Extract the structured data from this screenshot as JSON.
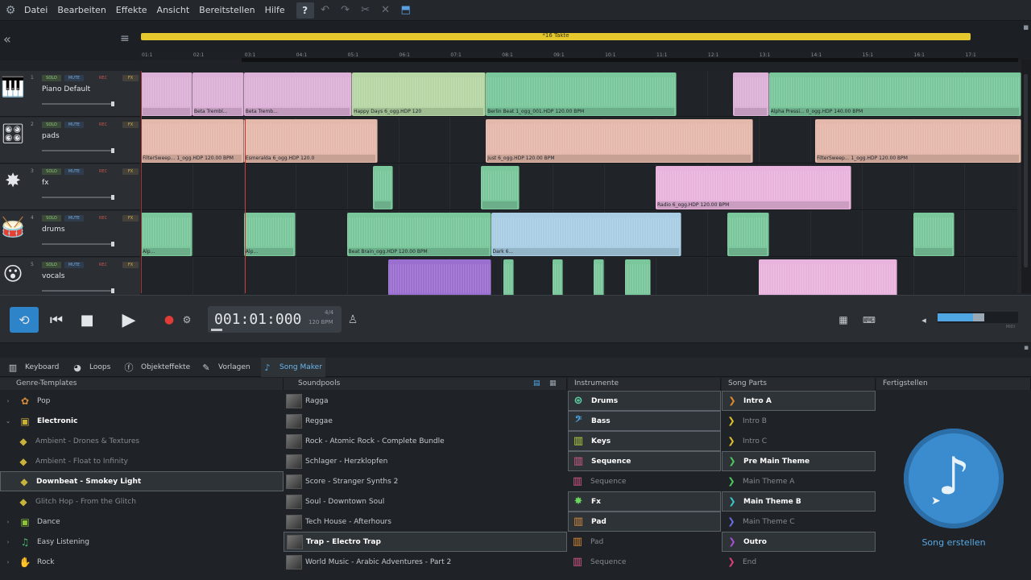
{
  "menu": {
    "items": [
      "Datei",
      "Bearbeiten",
      "Effekte",
      "Ansicht",
      "Bereitstellen",
      "Hilfe"
    ]
  },
  "arranger": {
    "loop_label": "*16 Takte",
    "ruler_ticks": [
      "01:1",
      "02:1",
      "03:1",
      "04:1",
      "05:1",
      "06:1",
      "07:1",
      "08:1",
      "09:1",
      "10:1",
      "11:1",
      "12:1",
      "13:1",
      "14:1",
      "15:1",
      "16:1",
      "17:1"
    ]
  },
  "tracks": [
    {
      "num": "1",
      "name": "Piano Default",
      "icon": "piano-icon",
      "icon_glyph": "🎹",
      "clips": [
        {
          "start": 0,
          "len": 1.0,
          "color": "c-pink",
          "label": ""
        },
        {
          "start": 1.0,
          "len": 1.0,
          "color": "c-pink",
          "label": "Beta Trembl..."
        },
        {
          "start": 2.0,
          "len": 2.1,
          "color": "c-pink",
          "label": "Beta Tremb..."
        },
        {
          "start": 4.1,
          "len": 2.6,
          "color": "c-lgreen",
          "label": "Happy Days 6_ogg.HDP 120"
        },
        {
          "start": 6.7,
          "len": 3.7,
          "color": "c-green",
          "label": "Berlin Beat 1_ogg_001.HDP 120.00 BPM"
        },
        {
          "start": 11.5,
          "len": 0.7,
          "color": "c-pink",
          "label": ""
        },
        {
          "start": 12.2,
          "len": 4.9,
          "color": "c-green",
          "label": "Alpha Pressi... 0_ogg.HDP 140.00 BPM"
        }
      ]
    },
    {
      "num": "2",
      "name": "pads",
      "icon": "keyboard-icon",
      "icon_glyph": "🎛",
      "clips": [
        {
          "start": 0,
          "len": 2.0,
          "color": "c-salmon",
          "label": "FilterSweep... 1_ogg.HDP 120.00 BPM"
        },
        {
          "start": 2.0,
          "len": 2.6,
          "color": "c-salmon",
          "label": "Esmeralda 6_ogg.HDP 120.0"
        },
        {
          "start": 6.7,
          "len": 5.2,
          "color": "c-salmon",
          "label": "Just 6_ogg.HDP 120.00 BPM"
        },
        {
          "start": 13.1,
          "len": 4.0,
          "color": "c-salmon",
          "label": "FilterSweep... 1_ogg.HDP 120.00 BPM"
        }
      ]
    },
    {
      "num": "3",
      "name": "fx",
      "icon": "fx-burst-icon",
      "icon_glyph": "✸",
      "clips": [
        {
          "start": 4.5,
          "len": 0.4,
          "color": "c-green",
          "label": ""
        },
        {
          "start": 6.6,
          "len": 0.75,
          "color": "c-green",
          "label": ""
        },
        {
          "start": 10.0,
          "len": 3.8,
          "color": "c-pinkv",
          "label": "Radio 6_ogg.HDP 120.00 BPM"
        }
      ]
    },
    {
      "num": "4",
      "name": "drums",
      "icon": "drums-icon",
      "icon_glyph": "🥁",
      "clips": [
        {
          "start": 0,
          "len": 1.0,
          "color": "c-green",
          "label": "Alp..."
        },
        {
          "start": 2.0,
          "len": 1.0,
          "color": "c-green",
          "label": "Alp..."
        },
        {
          "start": 4.0,
          "len": 2.8,
          "color": "c-green",
          "label": "Beat Brain_ogg.HDP 120.00 BPM"
        },
        {
          "start": 6.8,
          "len": 3.7,
          "color": "c-blue",
          "label": "Dark 6..."
        },
        {
          "start": 11.4,
          "len": 0.8,
          "color": "c-green",
          "label": ""
        },
        {
          "start": 15.0,
          "len": 0.8,
          "color": "c-green",
          "label": ""
        }
      ]
    },
    {
      "num": "5",
      "name": "vocals",
      "icon": "vocals-icon",
      "icon_glyph": "😮",
      "clips": [
        {
          "start": 4.8,
          "len": 2.0,
          "color": "c-purple",
          "label": ""
        },
        {
          "start": 7.05,
          "len": 0.2,
          "color": "c-green",
          "label": ""
        },
        {
          "start": 8.0,
          "len": 0.2,
          "color": "c-green",
          "label": ""
        },
        {
          "start": 8.8,
          "len": 0.2,
          "color": "c-green",
          "label": ""
        },
        {
          "start": 9.4,
          "len": 0.5,
          "color": "c-green",
          "label": ""
        },
        {
          "start": 12.0,
          "len": 2.7,
          "color": "c-pinkv",
          "label": ""
        }
      ]
    }
  ],
  "track_buttons": {
    "solo": "SOLO",
    "mute": "MUTE",
    "rec": "REC",
    "fx": "FX"
  },
  "transport": {
    "time": "001:01:000",
    "signature": "4/4",
    "bpm": "120 BPM",
    "midi_label": "MIDI",
    "volume_level": 0.44
  },
  "tabs": [
    {
      "label": "Keyboard",
      "icon": "keyboard-icon",
      "glyph": "▥"
    },
    {
      "label": "Loops",
      "icon": "loops-icon",
      "glyph": "◕"
    },
    {
      "label": "Objekteffekte",
      "icon": "object-effects-icon",
      "glyph": "ⓕ"
    },
    {
      "label": "Vorlagen",
      "icon": "templates-icon",
      "glyph": "✎"
    },
    {
      "label": "Song Maker",
      "icon": "song-maker-icon",
      "glyph": "♪"
    }
  ],
  "columns": {
    "genre": {
      "header": "Genre-Templates",
      "items": [
        {
          "label": "Pop",
          "icon": "pop-genre-icon",
          "glyph": "✿",
          "color": "#d88a3a",
          "arrow": "›",
          "indent": 0,
          "state": "normal"
        },
        {
          "label": "Electronic",
          "icon": "electronic-genre-icon",
          "glyph": "▣",
          "color": "#c9b23b",
          "arrow": "⌄",
          "indent": 0,
          "state": "bright"
        },
        {
          "label": "Ambient - Drones & Textures",
          "icon": "template-diamond-icon",
          "glyph": "◆",
          "color": "#c9b23b",
          "arrow": "",
          "indent": 1,
          "state": "dim"
        },
        {
          "label": "Ambient - Float to Infinity",
          "icon": "template-diamond-icon",
          "glyph": "◆",
          "color": "#c9b23b",
          "arrow": "",
          "indent": 1,
          "state": "dim"
        },
        {
          "label": "Downbeat - Smokey Light",
          "icon": "template-diamond-icon",
          "glyph": "◆",
          "color": "#c9b23b",
          "arrow": "",
          "indent": 1,
          "state": "sel"
        },
        {
          "label": "Glitch Hop - From the Glitch",
          "icon": "template-diamond-icon",
          "glyph": "◆",
          "color": "#c9b23b",
          "arrow": "",
          "indent": 1,
          "state": "dim"
        },
        {
          "label": "Dance",
          "icon": "dance-genre-icon",
          "glyph": "▣",
          "color": "#8fc23b",
          "arrow": "›",
          "indent": 0,
          "state": "normal"
        },
        {
          "label": "Easy Listening",
          "icon": "easy-listening-genre-icon",
          "glyph": "♫",
          "color": "#49b96e",
          "arrow": "›",
          "indent": 0,
          "state": "normal"
        },
        {
          "label": "Rock",
          "icon": "rock-genre-icon",
          "glyph": "✋",
          "color": "#3a8bd0",
          "arrow": "›",
          "indent": 0,
          "state": "normal"
        }
      ]
    },
    "soundpools": {
      "header": "Soundpools",
      "items": [
        {
          "label": "Ragga",
          "state": "normal"
        },
        {
          "label": "Reggae",
          "state": "normal"
        },
        {
          "label": "Rock - Atomic Rock - Complete Bundle",
          "state": "normal"
        },
        {
          "label": "Schlager - Herzklopfen",
          "state": "normal"
        },
        {
          "label": "Score - Stranger Synths 2",
          "state": "normal"
        },
        {
          "label": "Soul - Downtown Soul",
          "state": "normal"
        },
        {
          "label": "Tech House - Afterhours",
          "state": "normal"
        },
        {
          "label": "Trap - Electro Trap",
          "state": "sel"
        },
        {
          "label": "World Music - Arabic Adventures - Part 2",
          "state": "normal"
        }
      ]
    },
    "instruments": {
      "header": "Instrumente",
      "items": [
        {
          "label": "Drums",
          "icon": "drums-instrument-icon",
          "glyph": "⊛",
          "color": "#5ed6a6",
          "state": "sel"
        },
        {
          "label": "Bass",
          "icon": "bass-instrument-icon",
          "glyph": "𝄢",
          "color": "#4aa6e6",
          "state": "sel"
        },
        {
          "label": "Keys",
          "icon": "keys-instrument-icon",
          "glyph": "▥",
          "color": "#b6d43a",
          "state": "sel"
        },
        {
          "label": "Sequence",
          "icon": "sequence-instrument-icon",
          "glyph": "▥",
          "color": "#d65c8a",
          "state": "sel"
        },
        {
          "label": "Sequence",
          "icon": "sequence-instrument-icon",
          "glyph": "▥",
          "color": "#d65c8a",
          "state": "dim"
        },
        {
          "label": "Fx",
          "icon": "fx-instrument-icon",
          "glyph": "✸",
          "color": "#6ad65c",
          "state": "sel"
        },
        {
          "label": "Pad",
          "icon": "pad-instrument-icon",
          "glyph": "▥",
          "color": "#d68a3a",
          "state": "sel"
        },
        {
          "label": "Pad",
          "icon": "pad-instrument-icon",
          "glyph": "▥",
          "color": "#d68a3a",
          "state": "dim"
        },
        {
          "label": "Sequence",
          "icon": "sequence-instrument-icon",
          "glyph": "▥",
          "color": "#d65c8a",
          "state": "dim"
        }
      ]
    },
    "songparts": {
      "header": "Song Parts",
      "items": [
        {
          "label": "Intro A",
          "color": "#e08a2d",
          "state": "sel"
        },
        {
          "label": "Intro B",
          "color": "#e0c02d",
          "state": "dim"
        },
        {
          "label": "Intro C",
          "color": "#e0c02d",
          "state": "dim"
        },
        {
          "label": "Pre Main Theme",
          "color": "#4fc75a",
          "state": "sel"
        },
        {
          "label": "Main Theme A",
          "color": "#4fc75a",
          "state": "dim"
        },
        {
          "label": "Main Theme B",
          "color": "#3ac7c7",
          "state": "sel"
        },
        {
          "label": "Main Theme C",
          "color": "#6b6de0",
          "state": "dim"
        },
        {
          "label": "Outro",
          "color": "#a84fd6",
          "state": "sel"
        },
        {
          "label": "End",
          "color": "#e0407a",
          "state": "dim"
        }
      ]
    },
    "finish": {
      "header": "Fertigstellen",
      "button_label": "Song erstellen"
    }
  }
}
